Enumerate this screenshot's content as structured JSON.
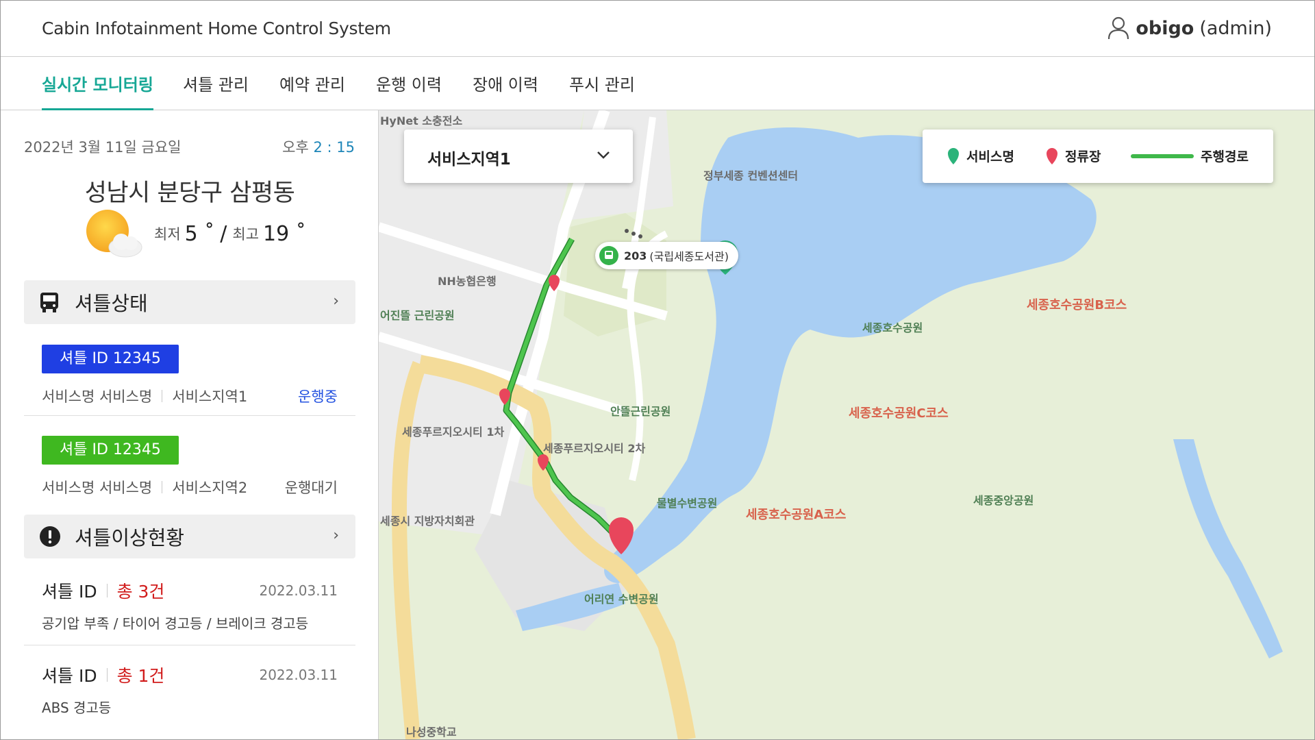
{
  "header": {
    "app_title": "Cabin Infotainment Home Control System",
    "user_name": "obigo",
    "user_role": "(admin)"
  },
  "tabs": [
    {
      "label": "실시간 모니터링",
      "active": true
    },
    {
      "label": "셔틀 관리",
      "active": false
    },
    {
      "label": "예약 관리",
      "active": false
    },
    {
      "label": "운행 이력",
      "active": false
    },
    {
      "label": "장애 이력",
      "active": false
    },
    {
      "label": "푸시 관리",
      "active": false
    }
  ],
  "panel": {
    "date": "2022년 3월 11일 금요일",
    "time_prefix": "오후",
    "time_value": "2 : 15",
    "location": "성남시 분당구 삼평동",
    "weather": {
      "icon": "partly-cloudy-icon",
      "min_label": "최저",
      "min_value": "5 ˚",
      "separator": "/",
      "max_label": "최고",
      "max_value": "19 ˚"
    },
    "shuttle_status": {
      "title": "셔틀상태",
      "icon": "bus-icon",
      "items": [
        {
          "badge": "셔틀 ID 12345",
          "badge_color": "#1f3fe3",
          "service": "서비스명 서비스명",
          "region": "서비스지역1",
          "status": "운행중",
          "status_color": "#2150e0"
        },
        {
          "badge": "셔틀 ID 12345",
          "badge_color": "#3fb820",
          "service": "서비스명 서비스명",
          "region": "서비스지역2",
          "status": "운행대기",
          "status_color": "#555555"
        }
      ]
    },
    "shuttle_issues": {
      "title": "셔틀이상현황",
      "icon": "alert-icon",
      "items": [
        {
          "label": "셔틀 ID",
          "count": "총 3건",
          "date": "2022.03.11",
          "desc": "공기압 부족 / 타이어 경고등 / 브레이크 경고등"
        },
        {
          "label": "셔틀 ID",
          "count": "총 1건",
          "date": "2022.03.11",
          "desc": "ABS 경고등"
        }
      ]
    }
  },
  "map": {
    "region_select": {
      "value": "서비스지역1"
    },
    "legend": {
      "service": "서비스명",
      "service_color": "#2bb37a",
      "stop": "정류장",
      "stop_color": "#e8465c",
      "route": "주행경로",
      "route_color": "#3fb84a"
    },
    "stop_bubble": {
      "number": "203",
      "name": "(국립세종도서관)"
    },
    "labels": [
      {
        "text": "HyNet 소충전소",
        "kind": "gray"
      },
      {
        "text": "정부세종 컨벤션센터",
        "kind": "gray"
      },
      {
        "text": "NH농협은행",
        "kind": "gray"
      },
      {
        "text": "어진뜰 근린공원",
        "kind": "green"
      },
      {
        "text": "세종호수공원B코스",
        "kind": "red"
      },
      {
        "text": "세종호수공원",
        "kind": "green"
      },
      {
        "text": "세종호수공원C코스",
        "kind": "red"
      },
      {
        "text": "안뜰근린공원",
        "kind": "green"
      },
      {
        "text": "세종푸르지오시티 1차",
        "kind": "gray"
      },
      {
        "text": "세종푸르지오시티 2차",
        "kind": "gray"
      },
      {
        "text": "세종호수공원A코스",
        "kind": "red"
      },
      {
        "text": "물별수변공원",
        "kind": "green"
      },
      {
        "text": "세종중앙공원",
        "kind": "green"
      },
      {
        "text": "세종시 지방자치회관",
        "kind": "gray"
      },
      {
        "text": "어리연 수변공원",
        "kind": "green"
      },
      {
        "text": "나성중학교",
        "kind": "gray"
      }
    ]
  }
}
